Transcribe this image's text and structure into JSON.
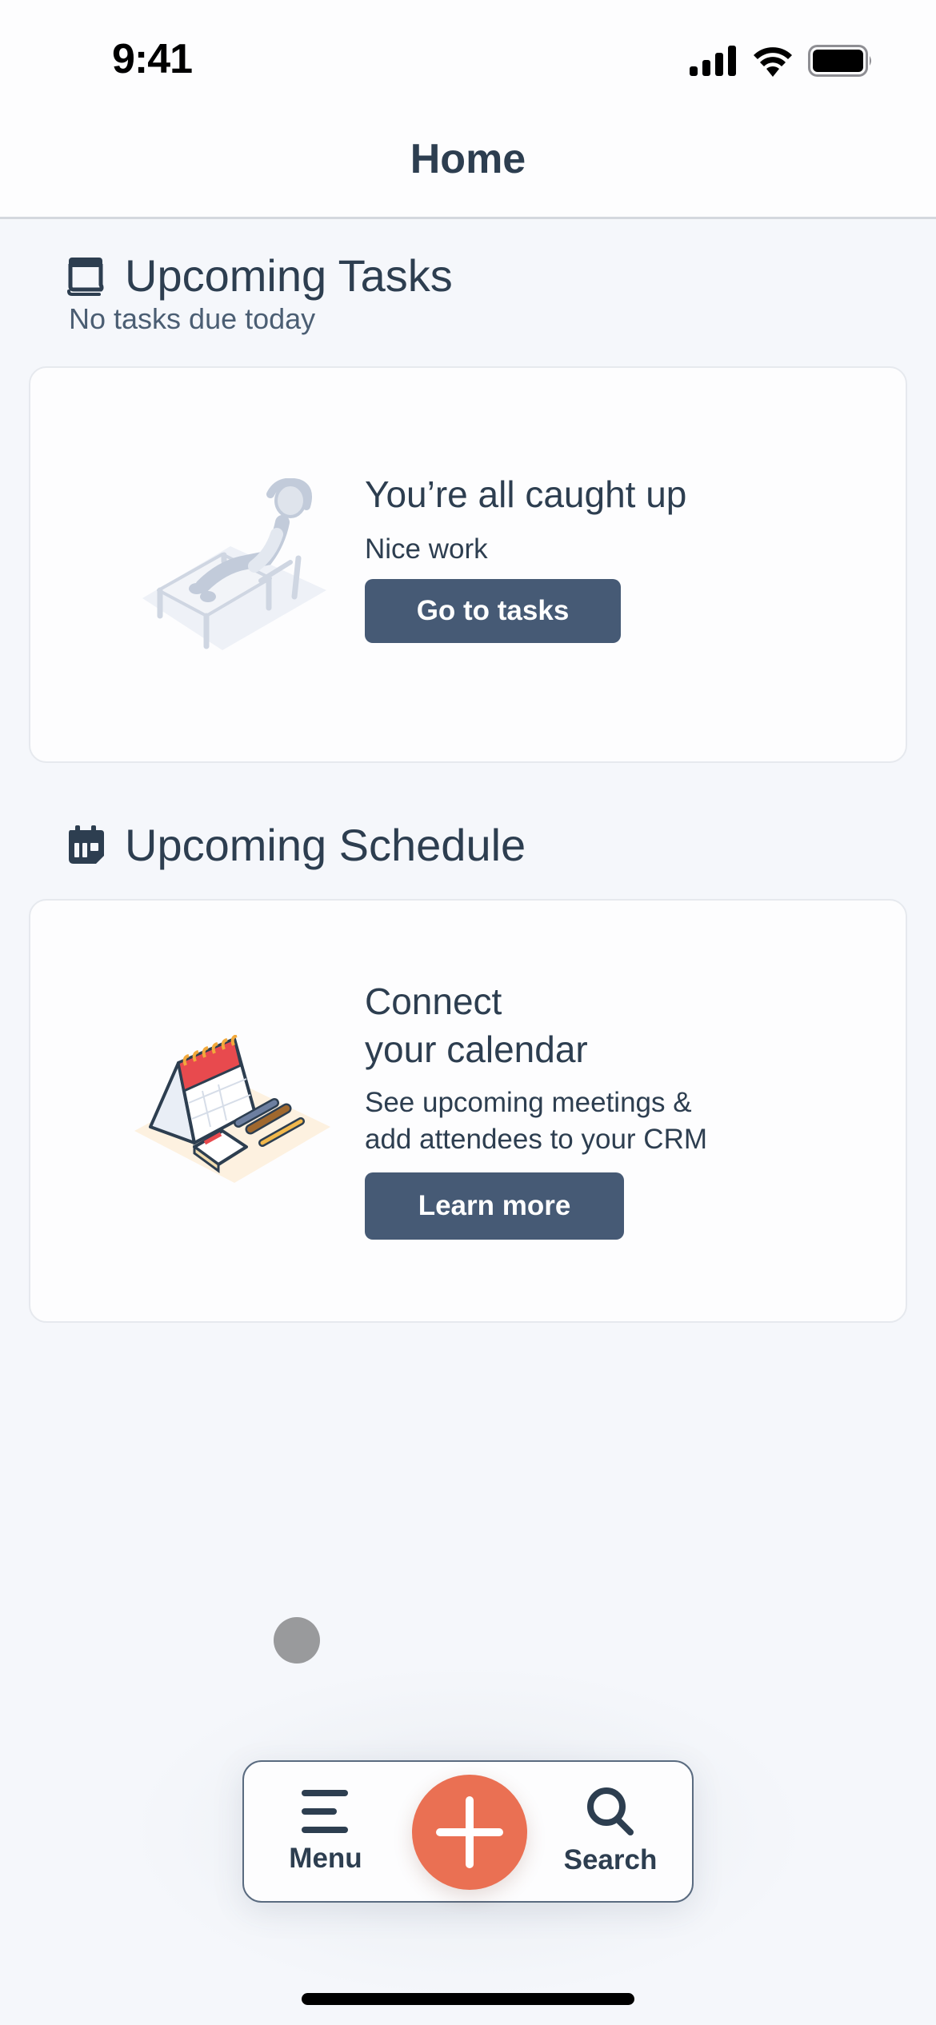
{
  "status_bar": {
    "time": "9:41",
    "icons": [
      "cellular-signal-icon",
      "wifi-icon",
      "battery-icon"
    ]
  },
  "header": {
    "title": "Home"
  },
  "tasks_section": {
    "icon": "task-book-icon",
    "title": "Upcoming Tasks",
    "subtitle": "No tasks due today",
    "card": {
      "illustration": "person-relaxing-on-lounge-chair",
      "title": "You’re all caught up",
      "text": "Nice work",
      "button_label": "Go to tasks"
    }
  },
  "schedule_section": {
    "icon": "calendar-icon",
    "title": "Upcoming Schedule",
    "card": {
      "illustration": "desk-calendar-with-pens",
      "title_line1": "Connect",
      "title_line2": "your calendar",
      "text_line1": "See upcoming meetings &",
      "text_line2": "add attendees to your CRM",
      "button_label": "Learn more"
    }
  },
  "tab_bar": {
    "menu_label": "Menu",
    "menu_icon": "hamburger-menu-icon",
    "create_icon": "plus-icon",
    "search_label": "Search",
    "search_icon": "search-icon"
  },
  "colors": {
    "background": "#f5f7fb",
    "text_primary": "#2d3e50",
    "button": "#465a75",
    "fab_accent": "#ea7053"
  }
}
